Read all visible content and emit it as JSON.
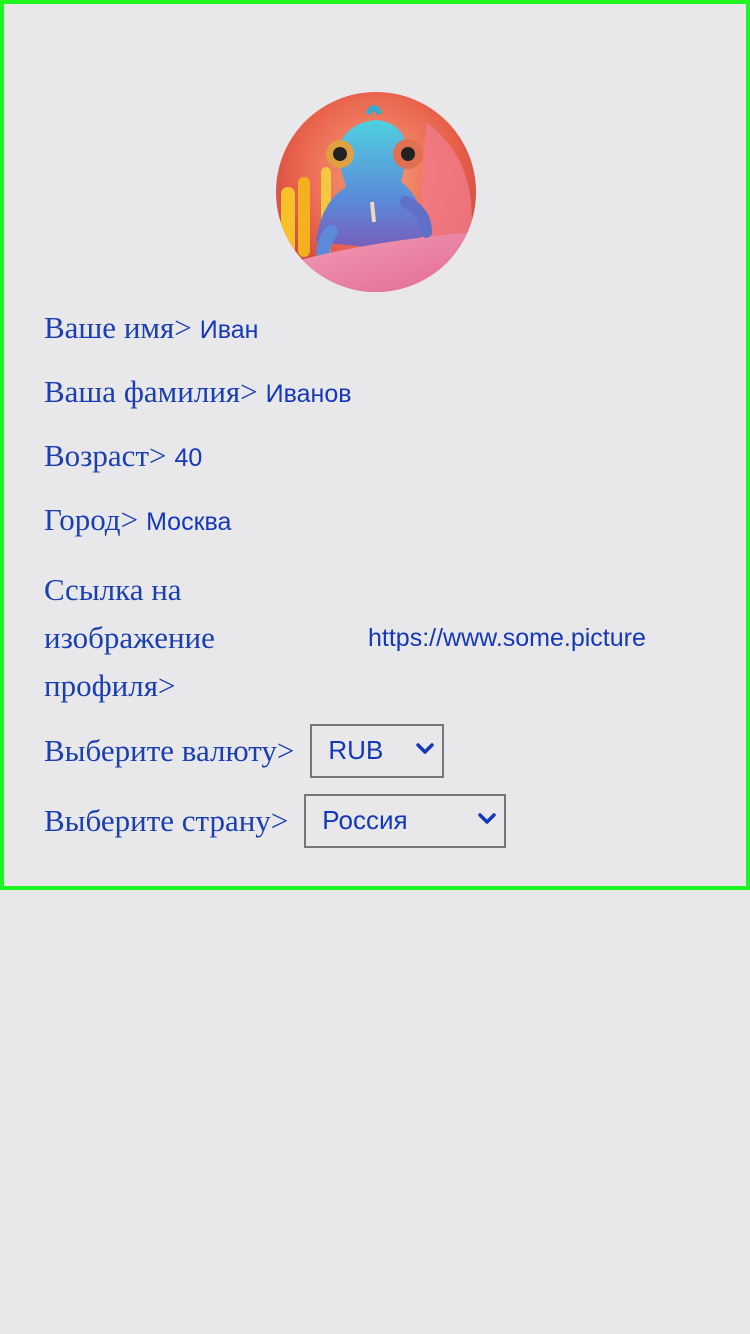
{
  "profile": {
    "avatar_alt": "chameleon-photo",
    "fields": [
      {
        "label": "Ваше имя>",
        "value": "Иван"
      },
      {
        "label": "Ваша фамилия>",
        "value": "Иванов"
      },
      {
        "label": "Возраст>",
        "value": "40"
      },
      {
        "label": "Город>",
        "value": "Москва"
      }
    ],
    "image_link": {
      "label": "Ссылка на изображение профиля>",
      "value": "https://www.some.picture"
    },
    "currency": {
      "label": "Выберите валюту>",
      "selected": "RUB"
    },
    "country": {
      "label": "Выберите страну>",
      "selected": "Россия"
    }
  },
  "colors": {
    "border": "#1ff51f",
    "text": "#1a3fb0",
    "background": "#e8e7e9"
  }
}
